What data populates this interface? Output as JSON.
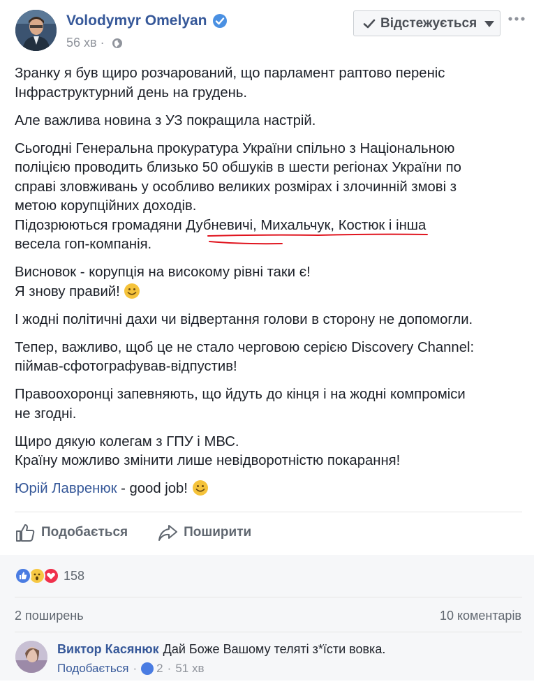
{
  "post": {
    "author": "Volodymyr Omelyan",
    "time": "56 хв",
    "follow_label": "Відстежується",
    "paragraphs": [
      [
        "Зранку я був щиро розчарований, що парламент раптово переніс",
        "Інфраструктурний день на грудень."
      ],
      [
        "Але важлива новина з УЗ покращила настрій."
      ],
      [
        "Сьогодні Генеральна прокуратура України спільно з Національною",
        "поліцією проводить близько 50 обшуків в шести регіонах України по",
        "справі зловживань у особливо великих розмірах і злочинній змові з",
        "метою корупційних доходів.",
        "Підозрюються громадяни Дубневичі, Михальчук, Костюк і інша",
        "весела гоп-компанія."
      ],
      [
        "Висновок - корупція на високому рівні таки є!",
        "Я знову правий!"
      ],
      [
        "І жодні політичні дахи чи відвертання голови в сторону не допомогли."
      ],
      [
        "Тепер, важливо, щоб це не стало черговою серією Discovery Channel:",
        "піймав-сфотографував-відпустив!"
      ],
      [
        "Правоохоронці запевняють, що йдуть до кінця і на жодні компроміси",
        "не згодні."
      ],
      [
        "Щиро дякую колегам з ГПУ і МВС.",
        "Країну можливо змінити лише невідворотністю покарання!"
      ]
    ],
    "mention_name": "Юрій Лавренюк",
    "mention_suffix": " - good job!"
  },
  "actions": {
    "like_label": "Подобається",
    "share_label": "Поширити"
  },
  "stats": {
    "reactions_count": "158",
    "shares": "2 поширень",
    "comments": "10 коментарів"
  },
  "comment": {
    "author": "Виктор Касянюк",
    "text": "Дай Боже Вашому теляті з*їсти вовка.",
    "like_label": "Подобається",
    "likes": "2",
    "time": "51 хв"
  },
  "colors": {
    "link_blue": "#365899",
    "like_blue": "#4a7ce2",
    "love_red": "#f0304c",
    "wow_yellow": "#f7c843",
    "annotation_red": "#e0141e"
  },
  "icons": [
    "verified-badge-icon",
    "globe-icon",
    "check-icon",
    "caret-down-icon",
    "more-icon",
    "like-icon",
    "share-icon",
    "smile-emoji-icon"
  ]
}
